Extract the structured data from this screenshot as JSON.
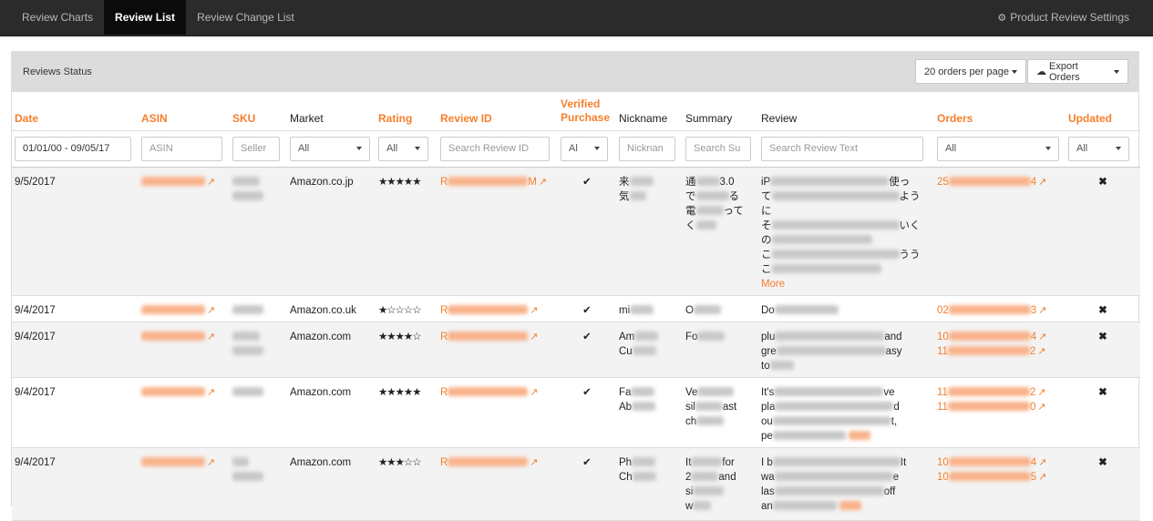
{
  "nav": {
    "tabs": [
      {
        "label": "Review Charts"
      },
      {
        "label": "Review List"
      },
      {
        "label": "Review Change List"
      }
    ],
    "settings_label": "Product Review Settings"
  },
  "panel": {
    "title": "Reviews Status",
    "per_page_label": "20 orders per page",
    "export_label": "Export Orders"
  },
  "columns": {
    "date": "Date",
    "asin": "ASIN",
    "sku": "SKU",
    "market": "Market",
    "rating": "Rating",
    "review_id": "Review ID",
    "verified": "Verified Purchase",
    "nickname": "Nickname",
    "summary": "Summary",
    "review": "Review",
    "orders": "Orders",
    "updated": "Updated"
  },
  "filters": {
    "date_range": "01/01/00 - 09/05/17",
    "asin_placeholder": "ASIN",
    "sku_placeholder": "Seller",
    "market_value": "All",
    "rating_value": "All",
    "review_id_placeholder": "Search Review ID",
    "verified_value": "Al",
    "nickname_placeholder": "Nicknan",
    "summary_placeholder": "Search Su",
    "review_placeholder": "Search Review Text",
    "orders_value": "All",
    "updated_value": "All"
  },
  "rows": [
    {
      "date": "9/5/2017",
      "market": "Amazon.co.jp",
      "stars": "★★★★★",
      "review_id_prefix": "R",
      "review_id_suffix": "M",
      "check": "✔",
      "nickname_visible": "来",
      "nickname_line2": "気",
      "summary_line1": "通",
      "summary_line1_end": "3.0",
      "summary_line2": "で",
      "summary_line2_end": "る",
      "summary_line3": "電",
      "summary_line3_end": "って",
      "summary_line4": "く",
      "review_line1": "iP",
      "review_line1_end": "使っ",
      "review_line2": "て",
      "review_line2_end": "よう",
      "review_line3": "に",
      "review_line4": "そ",
      "review_line4_end": "いく",
      "review_line5": "の",
      "review_line6": "こ",
      "review_line6_end": "うう",
      "review_line7": "こ",
      "more": "More",
      "order1_prefix": "25",
      "order1_suffix": "4",
      "updated": "✖"
    },
    {
      "date": "9/4/2017",
      "market": "Amazon.co.uk",
      "stars": "★☆☆☆☆",
      "review_id_prefix": "R",
      "check": "✔",
      "nickname_visible": "mi",
      "summary_visible": "O",
      "review_visible": "Do",
      "order1_prefix": "02",
      "order1_suffix": "3",
      "updated": "✖"
    },
    {
      "date": "9/4/2017",
      "market": "Amazon.com",
      "stars": "★★★★☆",
      "review_id_prefix": "R",
      "check": "✔",
      "nickname_visible": "Am",
      "nickname_line2": "Cu",
      "summary_visible": "Fo",
      "review_line1": "plu",
      "review_line1_end": "and",
      "review_line2": "gre",
      "review_line2_end": "asy",
      "review_line3": "to",
      "order1_prefix": "10",
      "order1_suffix": "4",
      "order2_prefix": "11",
      "order2_suffix": "2",
      "updated": "✖"
    },
    {
      "date": "9/4/2017",
      "market": "Amazon.com",
      "stars": "★★★★★",
      "review_id_prefix": "R",
      "check": "✔",
      "nickname_visible": "Fa",
      "nickname_line2": "Ab",
      "summary_line1": "Ve",
      "summary_line2": "sil",
      "summary_line2_end": "ast",
      "summary_line3": "ch",
      "review_line1": "It's",
      "review_line1_end": "ve",
      "review_line2": "pla",
      "review_line2_end": "d",
      "review_line3": "ou",
      "review_line3_end": "t,",
      "review_line4": "pe",
      "order1_prefix": "11",
      "order1_suffix": "2",
      "order2_prefix": "11",
      "order2_suffix": "0",
      "updated": "✖"
    },
    {
      "date": "9/4/2017",
      "market": "Amazon.com",
      "stars": "★★★☆☆",
      "review_id_prefix": "R",
      "check": "✔",
      "nickname_visible": "Ph",
      "nickname_line2": "Ch",
      "summary_line1": "It",
      "summary_line1_end": "for",
      "summary_line2": "2",
      "summary_line2_end": "and",
      "summary_line3": "si",
      "summary_line4": "w",
      "review_line1": "I b",
      "review_line1_end": "It",
      "review_line2": "wa",
      "review_line2_end": "e",
      "review_line3": "las",
      "review_line3_end": "off",
      "review_line4": "an",
      "order1_prefix": "10",
      "order1_suffix": "4",
      "order2_prefix": "10",
      "order2_suffix": "5",
      "updated": "✖"
    }
  ],
  "colors": {
    "accent": "#f57f2a",
    "nav_bg": "#2b2b2b",
    "nav_active_bg": "#0b0b0b",
    "header_bg": "#dcdcdc"
  },
  "icons": {
    "external_link": "external-link-icon",
    "gear": "gear-icon",
    "cloud_download": "cloud-download-icon",
    "check": "check-icon",
    "close": "close-icon"
  }
}
